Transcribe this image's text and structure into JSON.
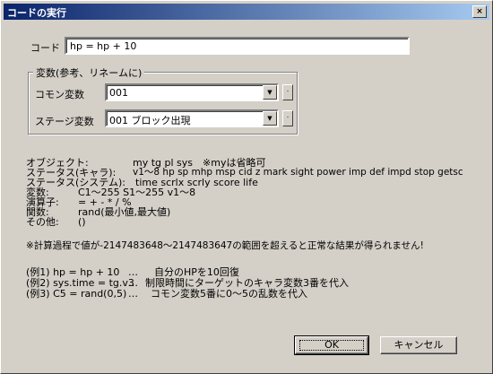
{
  "window": {
    "title": "コードの実行",
    "close_label": "×"
  },
  "code": {
    "label": "コード",
    "value": "hp = hp + 10"
  },
  "variables": {
    "group_title": "変数(参考、リネームに)",
    "common": {
      "label": "コモン変数",
      "value": "001",
      "button": "."
    },
    "stage": {
      "label": "ステージ変数",
      "value": "001 ブロック出現",
      "button": "."
    }
  },
  "info": {
    "object_label": "オブジェクト:",
    "object_value": "my tg pl sys　※myは省略可",
    "status_chara_label": "ステータス(キャラ):",
    "status_chara_value": "v1〜8 hp sp mhp msp cid z mark sight power imp def impd stop getsc",
    "status_system_label": "ステータス(システム):",
    "status_system_value": "time scrlx scrly score life",
    "variable_label": "変数:",
    "variable_value": "C1〜255 S1〜255 v1〜8",
    "operator_label": "演算子:",
    "operator_value": "= + - * / %",
    "function_label": "関数:",
    "function_value": "rand(最小値,最大値)",
    "other_label": "その他:",
    "other_value": "()"
  },
  "warning": "※計算過程で値が-2147483648〜2147483647の範囲を超えると正常な結果が得られません!",
  "examples": [
    {
      "code": "(例1) hp = hp + 10",
      "sep": "…",
      "desc": "自分のHPを10回復"
    },
    {
      "code": "(例2) sys.time = tg.v3",
      "sep": "…",
      "desc": "制限時間にターゲットのキャラ変数3番を代入"
    },
    {
      "code": "(例3) C5 = rand(0,5)",
      "sep": "…",
      "desc": "コモン変数5番に0〜5の乱数を代入"
    }
  ],
  "buttons": {
    "ok": "OK",
    "cancel": "キャンセル"
  }
}
